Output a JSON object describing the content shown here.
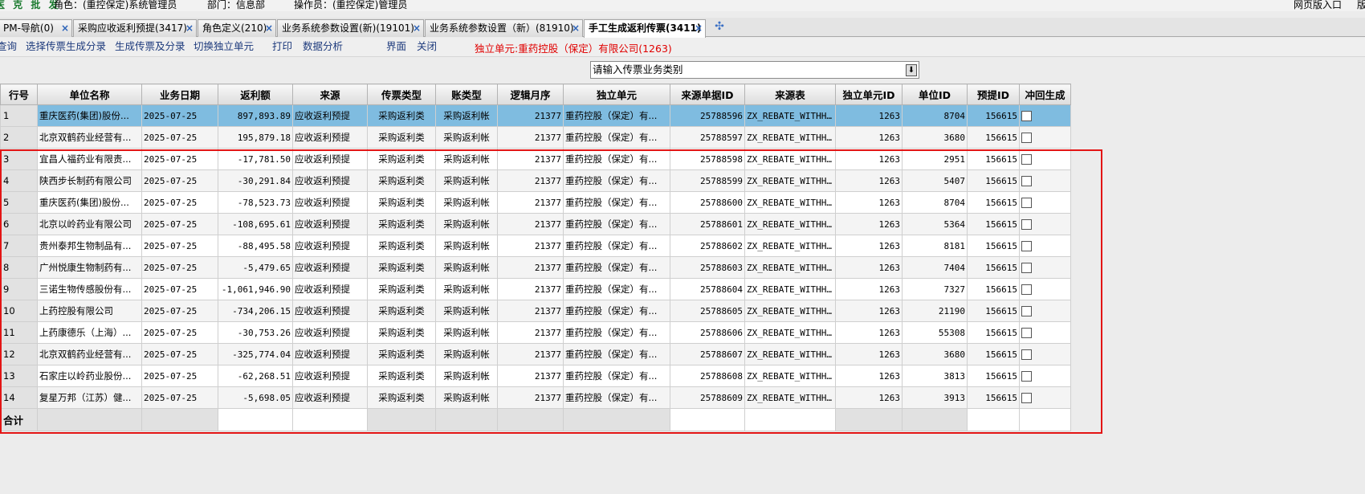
{
  "infobar": {
    "brand": "医 克 批 发",
    "role": "角色：(重控保定)系统管理员",
    "dept": "部门：信息部",
    "operator": "操作员：(重控保定)管理员",
    "right_link": "网页版入口",
    "right_edge": "版"
  },
  "tabs": [
    {
      "label": "PM-导航(0)"
    },
    {
      "label": "采购应收返利预提(3417)"
    },
    {
      "label": "角色定义(210)"
    },
    {
      "label": "业务系统参数设置(新)(19101)"
    },
    {
      "label": "业务系统参数设置（新）(81910)"
    },
    {
      "label": "手工生成返利传票(3411)"
    }
  ],
  "tab_close_glyph": "×",
  "tab_add_glyph": "✣",
  "menu": {
    "items": [
      "查询",
      "选择传票生成分录",
      "生成传票及分录",
      "切换独立单元",
      "打印",
      "数据分析",
      "界面",
      "关闭"
    ],
    "unit": "独立单元:重药控股（保定）有限公司(1263)"
  },
  "filter": {
    "label": "请输入传票业务类别",
    "value": "",
    "button_glyph": "⬇"
  },
  "table": {
    "columns": [
      "行号",
      "单位名称",
      "业务日期",
      "返利额",
      "来源",
      "传票类型",
      "账类型",
      "逻辑月序",
      "独立单元",
      "来源单据ID",
      "来源表",
      "独立单元ID",
      "单位ID",
      "预提ID",
      "冲回生成"
    ],
    "rows": [
      {
        "no": "1",
        "name": "重庆医药(集团)股份...",
        "date": "2025-07-25",
        "amount": "897,893.89",
        "source": "应收返利预提",
        "vtype": "采购返利类",
        "acct": "采购返利帐",
        "month": "21377",
        "unit": "重药控股（保定）有...",
        "src_id": "25788596",
        "src_table": "ZX_REBATE_WITHH...",
        "unit_id": "1263",
        "comp_id": "8704",
        "accrual_id": "156615"
      },
      {
        "no": "2",
        "name": "北京双鹤药业经营有...",
        "date": "2025-07-25",
        "amount": "195,879.18",
        "source": "应收返利预提",
        "vtype": "采购返利类",
        "acct": "采购返利帐",
        "month": "21377",
        "unit": "重药控股（保定）有...",
        "src_id": "25788597",
        "src_table": "ZX_REBATE_WITHH...",
        "unit_id": "1263",
        "comp_id": "3680",
        "accrual_id": "156615"
      },
      {
        "no": "3",
        "name": "宜昌人福药业有限责...",
        "date": "2025-07-25",
        "amount": "-17,781.50",
        "source": "应收返利预提",
        "vtype": "采购返利类",
        "acct": "采购返利帐",
        "month": "21377",
        "unit": "重药控股（保定）有...",
        "src_id": "25788598",
        "src_table": "ZX_REBATE_WITHH...",
        "unit_id": "1263",
        "comp_id": "2951",
        "accrual_id": "156615"
      },
      {
        "no": "4",
        "name": "陕西步长制药有限公司",
        "date": "2025-07-25",
        "amount": "-30,291.84",
        "source": "应收返利预提",
        "vtype": "采购返利类",
        "acct": "采购返利帐",
        "month": "21377",
        "unit": "重药控股（保定）有...",
        "src_id": "25788599",
        "src_table": "ZX_REBATE_WITHH...",
        "unit_id": "1263",
        "comp_id": "5407",
        "accrual_id": "156615"
      },
      {
        "no": "5",
        "name": "重庆医药(集团)股份...",
        "date": "2025-07-25",
        "amount": "-78,523.73",
        "source": "应收返利预提",
        "vtype": "采购返利类",
        "acct": "采购返利帐",
        "month": "21377",
        "unit": "重药控股（保定）有...",
        "src_id": "25788600",
        "src_table": "ZX_REBATE_WITHH...",
        "unit_id": "1263",
        "comp_id": "8704",
        "accrual_id": "156615"
      },
      {
        "no": "6",
        "name": "北京以岭药业有限公司",
        "date": "2025-07-25",
        "amount": "-108,695.61",
        "source": "应收返利预提",
        "vtype": "采购返利类",
        "acct": "采购返利帐",
        "month": "21377",
        "unit": "重药控股（保定）有...",
        "src_id": "25788601",
        "src_table": "ZX_REBATE_WITHH...",
        "unit_id": "1263",
        "comp_id": "5364",
        "accrual_id": "156615"
      },
      {
        "no": "7",
        "name": "贵州泰邦生物制品有...",
        "date": "2025-07-25",
        "amount": "-88,495.58",
        "source": "应收返利预提",
        "vtype": "采购返利类",
        "acct": "采购返利帐",
        "month": "21377",
        "unit": "重药控股（保定）有...",
        "src_id": "25788602",
        "src_table": "ZX_REBATE_WITHH...",
        "unit_id": "1263",
        "comp_id": "8181",
        "accrual_id": "156615"
      },
      {
        "no": "8",
        "name": "广州悦康生物制药有...",
        "date": "2025-07-25",
        "amount": "-5,479.65",
        "source": "应收返利预提",
        "vtype": "采购返利类",
        "acct": "采购返利帐",
        "month": "21377",
        "unit": "重药控股（保定）有...",
        "src_id": "25788603",
        "src_table": "ZX_REBATE_WITHH...",
        "unit_id": "1263",
        "comp_id": "7404",
        "accrual_id": "156615"
      },
      {
        "no": "9",
        "name": "三诺生物传感股份有...",
        "date": "2025-07-25",
        "amount": "-1,061,946.90",
        "source": "应收返利预提",
        "vtype": "采购返利类",
        "acct": "采购返利帐",
        "month": "21377",
        "unit": "重药控股（保定）有...",
        "src_id": "25788604",
        "src_table": "ZX_REBATE_WITHH...",
        "unit_id": "1263",
        "comp_id": "7327",
        "accrual_id": "156615"
      },
      {
        "no": "10",
        "name": "上药控股有限公司",
        "date": "2025-07-25",
        "amount": "-734,206.15",
        "source": "应收返利预提",
        "vtype": "采购返利类",
        "acct": "采购返利帐",
        "month": "21377",
        "unit": "重药控股（保定）有...",
        "src_id": "25788605",
        "src_table": "ZX_REBATE_WITHH...",
        "unit_id": "1263",
        "comp_id": "21190",
        "accrual_id": "156615"
      },
      {
        "no": "11",
        "name": "上药康德乐（上海）...",
        "date": "2025-07-25",
        "amount": "-30,753.26",
        "source": "应收返利预提",
        "vtype": "采购返利类",
        "acct": "采购返利帐",
        "month": "21377",
        "unit": "重药控股（保定）有...",
        "src_id": "25788606",
        "src_table": "ZX_REBATE_WITHH...",
        "unit_id": "1263",
        "comp_id": "55308",
        "accrual_id": "156615"
      },
      {
        "no": "12",
        "name": "北京双鹤药业经营有...",
        "date": "2025-07-25",
        "amount": "-325,774.04",
        "source": "应收返利预提",
        "vtype": "采购返利类",
        "acct": "采购返利帐",
        "month": "21377",
        "unit": "重药控股（保定）有...",
        "src_id": "25788607",
        "src_table": "ZX_REBATE_WITHH...",
        "unit_id": "1263",
        "comp_id": "3680",
        "accrual_id": "156615"
      },
      {
        "no": "13",
        "name": "石家庄以岭药业股份...",
        "date": "2025-07-25",
        "amount": "-62,268.51",
        "source": "应收返利预提",
        "vtype": "采购返利类",
        "acct": "采购返利帐",
        "month": "21377",
        "unit": "重药控股（保定）有...",
        "src_id": "25788608",
        "src_table": "ZX_REBATE_WITHH...",
        "unit_id": "1263",
        "comp_id": "3813",
        "accrual_id": "156615"
      },
      {
        "no": "14",
        "name": "复星万邦（江苏）健...",
        "date": "2025-07-25",
        "amount": "-5,698.05",
        "source": "应收返利预提",
        "vtype": "采购返利类",
        "acct": "采购返利帐",
        "month": "21377",
        "unit": "重药控股（保定）有...",
        "src_id": "25788609",
        "src_table": "ZX_REBATE_WITHH...",
        "unit_id": "1263",
        "comp_id": "3913",
        "accrual_id": "156615"
      }
    ],
    "total_label": "合计",
    "selected_row": 1
  },
  "colors": {
    "selected_row": "#7fbce0",
    "highlight_box": "#e31515",
    "unit_text": "#e00000",
    "brand": "#1a7a2e"
  }
}
